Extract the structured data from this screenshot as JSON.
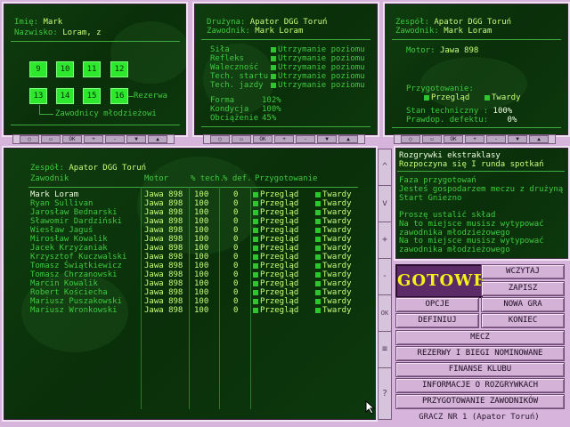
{
  "player_panel": {
    "name_label": "Imię:",
    "name_value": "Mark",
    "surname_label": "Nazwisko:",
    "surname_value": "Loram, z",
    "slots_top": [
      "9",
      "10",
      "11",
      "12"
    ],
    "slots_bottom": [
      "13",
      "14",
      "15",
      "16"
    ],
    "reserve_label": "Rezerwa",
    "juniors_label": "Zawodnicy młodzieżowi"
  },
  "skills_panel": {
    "team_label": "Drużyna:",
    "team_value": "Apator DGG Toruń",
    "rider_label": "Zawodnik:",
    "rider_value": "Mark Loram",
    "skills": [
      {
        "label": "Siła",
        "value": "Utrzymanie poziomu"
      },
      {
        "label": "Refleks",
        "value": "Utrzymanie poziomu"
      },
      {
        "label": "Waleczność",
        "value": "Utrzymanie poziomu"
      },
      {
        "label": "Tech. startu",
        "value": "Utrzymanie poziomu"
      },
      {
        "label": "Tech. jazdy",
        "value": "Utrzymanie poziomu"
      }
    ],
    "stats": [
      {
        "label": "Forma",
        "value": "102%"
      },
      {
        "label": "Kondycja",
        "value": "100%"
      },
      {
        "label": "Obciążenie",
        "value": "45%"
      }
    ]
  },
  "motor_panel": {
    "team_label": "Zespół:",
    "team_value": "Apator DGG Toruń",
    "rider_label": "Zawodnik:",
    "rider_value": "Mark Loram",
    "motor_label": "Motor:",
    "motor_value": "Jawa 898",
    "prep_label": "Przygotowanie:",
    "prep_opt1": "Przegląd",
    "prep_opt2": "Twardy",
    "tech_label": "Stan techniczny :",
    "tech_value": "100%",
    "defect_label": "Prawdop. defektu:",
    "defect_value": "0%"
  },
  "nav": {
    "ok": "OK",
    "plus": "+",
    "minus": "-"
  },
  "team_table": {
    "team_label": "Zespół:",
    "team_value": "Apator DGG Toruń",
    "headers": [
      "Zawodnik",
      "Motor",
      "% tech.",
      "% def.",
      "Przygotowanie"
    ],
    "rows": [
      {
        "name": "Mark Loram",
        "motor": "Jawa 898",
        "tech": "100",
        "def": "0",
        "prep1": "Przegląd",
        "prep2": "Twardy"
      },
      {
        "name": "Ryan Sullivan",
        "motor": "Jawa 898",
        "tech": "100",
        "def": "0",
        "prep1": "Przegląd",
        "prep2": "Twardy"
      },
      {
        "name": "Jarosław Bednarski",
        "motor": "Jawa 898",
        "tech": "100",
        "def": "0",
        "prep1": "Przegląd",
        "prep2": "Twardy"
      },
      {
        "name": "Sławomir Dardziński",
        "motor": "Jawa 898",
        "tech": "100",
        "def": "0",
        "prep1": "Przegląd",
        "prep2": "Twardy"
      },
      {
        "name": "Wiesław Jaguś",
        "motor": "Jawa 898",
        "tech": "100",
        "def": "0",
        "prep1": "Przegląd",
        "prep2": "Twardy"
      },
      {
        "name": "Mirosław Kowalik",
        "motor": "Jawa 898",
        "tech": "100",
        "def": "0",
        "prep1": "Przegląd",
        "prep2": "Twardy"
      },
      {
        "name": "Jacek Krzyżaniak",
        "motor": "Jawa 898",
        "tech": "100",
        "def": "0",
        "prep1": "Przegląd",
        "prep2": "Twardy"
      },
      {
        "name": "Krzysztof Kuczwalski",
        "motor": "Jawa 898",
        "tech": "100",
        "def": "0",
        "prep1": "Przegląd",
        "prep2": "Twardy"
      },
      {
        "name": "Tomasz Świątkiewicz",
        "motor": "Jawa 898",
        "tech": "100",
        "def": "0",
        "prep1": "Przegląd",
        "prep2": "Twardy"
      },
      {
        "name": "Tomasz Chrzanowski",
        "motor": "Jawa 898",
        "tech": "100",
        "def": "0",
        "prep1": "Przegląd",
        "prep2": "Twardy"
      },
      {
        "name": "Marcin Kowalik",
        "motor": "Jawa 898",
        "tech": "100",
        "def": "0",
        "prep1": "Przegląd",
        "prep2": "Twardy"
      },
      {
        "name": "Robert Kościecha",
        "motor": "Jawa 898",
        "tech": "100",
        "def": "0",
        "prep1": "Przegląd",
        "prep2": "Twardy"
      },
      {
        "name": "Mariusz Puszakowski",
        "motor": "Jawa 898",
        "tech": "100",
        "def": "0",
        "prep1": "Przegląd",
        "prep2": "Twardy"
      },
      {
        "name": "Mariusz Wronkowski",
        "motor": "Jawa 898",
        "tech": "100",
        "def": "0",
        "prep1": "Przegląd",
        "prep2": "Twardy"
      }
    ]
  },
  "side_buttons": {
    "up": "^",
    "down": "v",
    "plus": "+",
    "minus": "-",
    "ok": "OK",
    "help": "?"
  },
  "info_panel": {
    "title1": "Rozgrywki ekstraklasy",
    "title2": "Rozpoczyna się I runda spotkań",
    "lines": [
      "Faza przygotowań",
      "Jesteś gospodarzem meczu z drużyną",
      "Start Gniezno",
      "",
      "Proszę ustalić skład",
      "Na to miejsce musisz wytypować",
      "zawodnika młodzieżowego",
      "Na to miejsce musisz wytypować",
      "zawodnika młodzieżowego"
    ]
  },
  "menu": {
    "gotowe": "GOTOWE",
    "wczytaj": "WCZYTAJ",
    "zapisz": "ZAPISZ",
    "opcje": "OPCJE",
    "nowa_gra": "NOWA GRA",
    "definiuj": "DEFINIUJ",
    "koniec": "KONIEC",
    "mecz": "MECZ",
    "rezerwy": "REZERWY I BIEGI NOMINOWANE",
    "finanse": "FINANSE KLUBU",
    "informacje": "INFORMACJE O ROZGRYWKACH",
    "przygotowanie": "PRZYGOTOWANIE ZAWODNIKÓW",
    "status": "GRACZ NR 1   (Apator Toruń)"
  },
  "colors": {
    "background": "#d7b4dc",
    "panel": "#0f3d0f",
    "accent": "#c8ff7a",
    "gotowe": "#f2f21a"
  }
}
